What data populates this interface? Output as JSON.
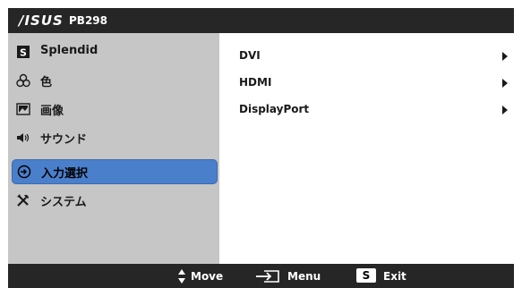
{
  "header": {
    "brand": "/ISUS",
    "model": "PB298"
  },
  "menu": {
    "items": [
      {
        "label": "Splendid",
        "icon": "splendid-icon"
      },
      {
        "label": "色",
        "icon": "color-icon"
      },
      {
        "label": "画像",
        "icon": "image-icon"
      },
      {
        "label": "サウンド",
        "icon": "sound-icon"
      },
      {
        "label": "入力選択",
        "icon": "input-select-icon",
        "selected": true
      },
      {
        "label": "システム",
        "icon": "system-setup-icon"
      }
    ]
  },
  "submenu": {
    "items": [
      {
        "label": "DVI"
      },
      {
        "label": "HDMI"
      },
      {
        "label": "DisplayPort"
      }
    ]
  },
  "footer": {
    "move_label": "Move",
    "menu_label": "Menu",
    "exit_key": "S",
    "exit_label": "Exit"
  },
  "colors": {
    "header_bg": "#262626",
    "menu_bg": "#c6c6c6",
    "selected_bg": "#4a7fcb",
    "panel_bg": "#ffffff"
  }
}
